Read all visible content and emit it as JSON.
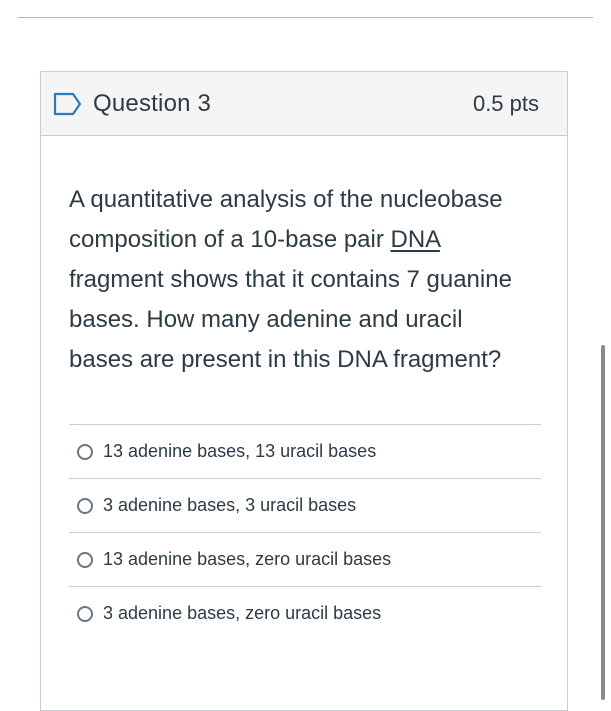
{
  "question": {
    "title": "Question 3",
    "points": "0.5 pts",
    "text_before_link": "A quantitative analysis of the nucleobase composition of a 10-base pair ",
    "link_term": "DNA",
    "text_after_link": " fragment shows that it contains 7 guanine bases. How many adenine and uracil bases are present in this DNA fragment?",
    "answers": [
      {
        "label": "13 adenine bases, 13 uracil bases",
        "selected": false
      },
      {
        "label": "3 adenine bases, 3 uracil bases",
        "selected": false
      },
      {
        "label": "13 adenine bases, zero uracil bases",
        "selected": false
      },
      {
        "label": "3 adenine bases, zero uracil bases",
        "selected": false
      }
    ]
  },
  "icons": {
    "flag": "bookmark-flag-icon"
  },
  "colors": {
    "accent": "#2b7abc",
    "header_bg": "#f5f5f5",
    "border": "#c7cdd1",
    "text": "#2d3b45"
  }
}
